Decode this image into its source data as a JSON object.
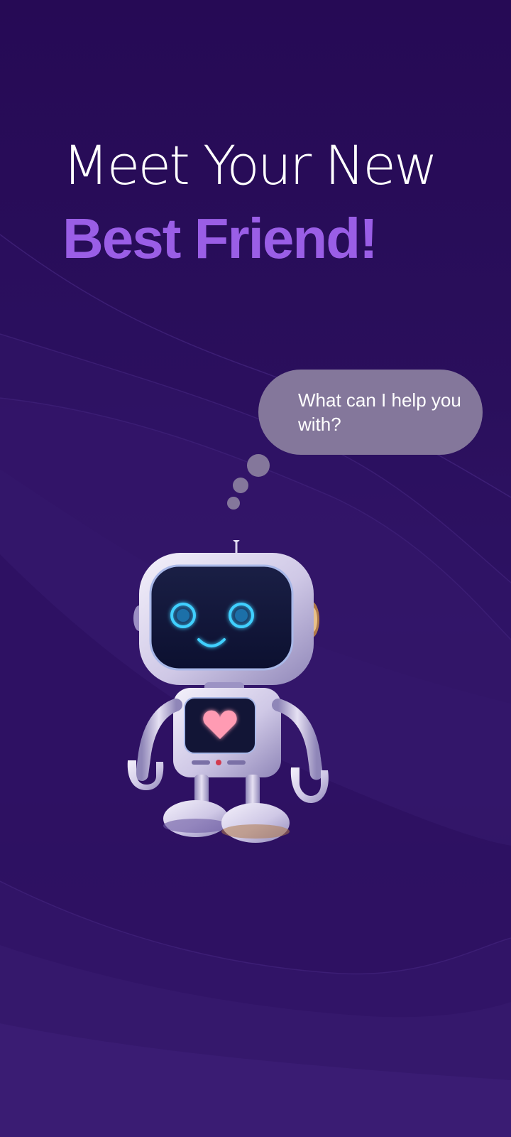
{
  "headline": {
    "line1": "Meet Your New",
    "line2": "Best Friend!"
  },
  "speech_bubble": {
    "text": "What can I help you with?"
  },
  "colors": {
    "background": "#260a55",
    "accent": "#9a5ee6",
    "bubble": "#84779b",
    "robot_glow": "#3fd0ff",
    "heart": "#ff8fa8"
  },
  "robot": {
    "icon": "robot-mascot-icon",
    "chest_icon": "heart-icon"
  }
}
